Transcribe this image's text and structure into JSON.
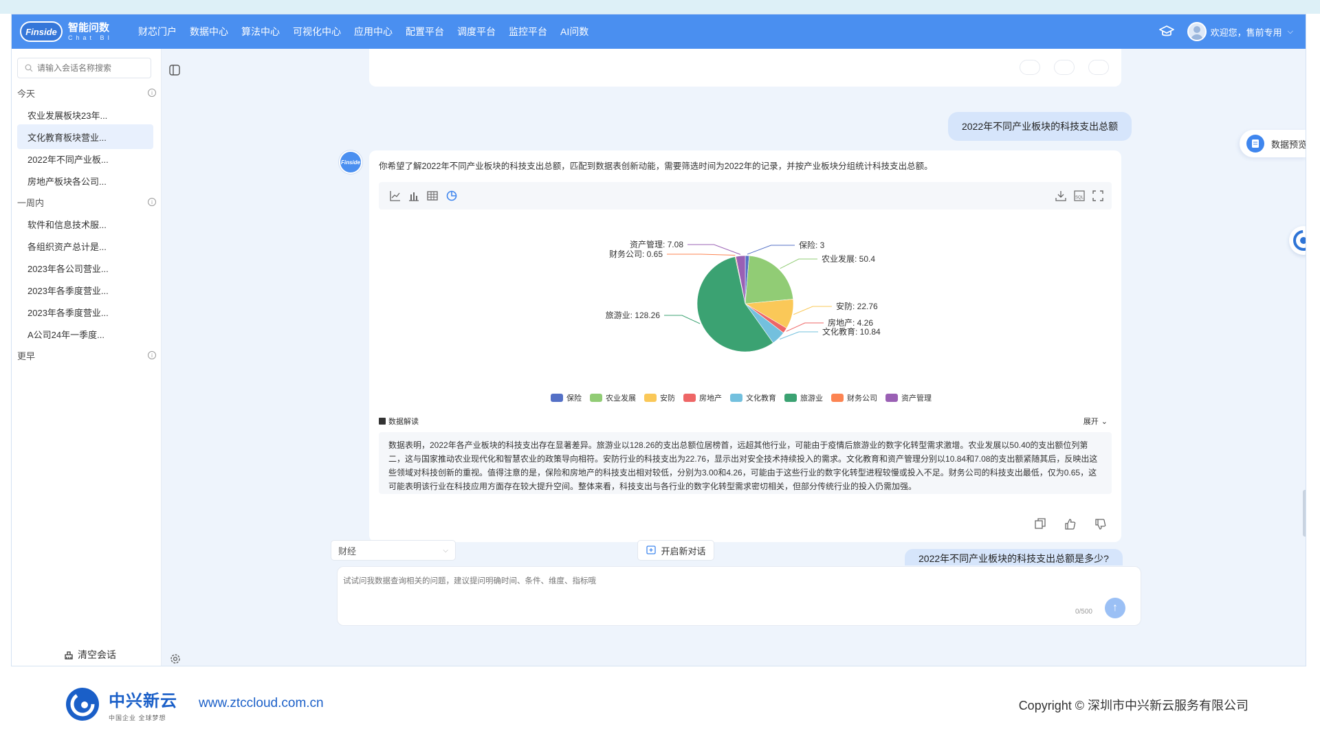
{
  "header": {
    "logo_badge": "Finside",
    "logo_title": "智能问数",
    "logo_subtitle": "Chat BI",
    "nav": [
      "财芯门户",
      "数据中心",
      "算法中心",
      "可视化中心",
      "应用中心",
      "配置平台",
      "调度平台",
      "监控平台",
      "AI问数"
    ],
    "welcome": "欢迎您，售前专用"
  },
  "sidebar": {
    "search_placeholder": "请输入会话名称搜索",
    "groups": [
      {
        "title": "今天",
        "items": [
          "农业发展板块23年...",
          "文化教育板块营业...",
          "2022年不同产业板...",
          "房地产板块各公司..."
        ]
      },
      {
        "title": "一周内",
        "items": [
          "软件和信息技术服...",
          "各组织资产总计是...",
          "2023年各公司营业...",
          "2023年各季度营业...",
          "2023年各季度营业...",
          "A公司24年一季度..."
        ]
      },
      {
        "title": "更早",
        "items": []
      }
    ],
    "active_item": "文化教育板块营业...",
    "clear_label": "清空会话"
  },
  "chat": {
    "user_question_1": "2022年不同产业板块的科技支出总额",
    "bot_avatar_text": "Finside",
    "bot_intro": "你希望了解2022年不同产业板块的科技支出总额，匹配到数据表创新动能，需要筛选时间为2022年的记录，并按产业板块分组统计科技支出总额。",
    "interpretation_label": "数据解读",
    "expand_label": "展开",
    "interpretation_text": "数据表明，2022年各产业板块的科技支出存在显著差异。旅游业以128.26的支出总额位居榜首，远超其他行业，可能由于疫情后旅游业的数字化转型需求激增。农业发展以50.40的支出额位列第二，这与国家推动农业现代化和智慧农业的政策导向相符。安防行业的科技支出为22.76，显示出对安全技术持续投入的需求。文化教育和资产管理分别以10.84和7.08的支出额紧随其后，反映出这些领域对科技创新的重视。值得注意的是，保险和房地产的科技支出相对较低，分别为3.00和4.26，可能由于这些行业的数字化转型进程较慢或投入不足。财务公司的科技支出最低，仅为0.65，这可能表明该行业在科技应用方面存在较大提升空间。整体来看，科技支出与各行业的数字化转型需求密切相关，但部分传统行业的投入仍需加强。",
    "user_question_2": "2022年不同产业板块的科技支出总额是多少?",
    "domain_select": "财经",
    "new_chat_label": "开启新对话",
    "input_placeholder": "试试问我数据查询相关的问题，建议提问明确时间、条件、维度、指标哦",
    "counter": "0/500"
  },
  "right_panel": {
    "data_preview": "数据预览"
  },
  "footer": {
    "brand": "中兴新云",
    "brand_sub": "中国企业 全球梦想",
    "url": "www.ztccloud.com.cn",
    "copyright": "Copyright © 深圳市中兴新云服务有限公司"
  },
  "chart_data": {
    "type": "pie",
    "categories": [
      "保险",
      "农业发展",
      "安防",
      "房地产",
      "文化教育",
      "旅游业",
      "财务公司",
      "资产管理"
    ],
    "values": [
      3,
      50.4,
      22.76,
      4.26,
      10.84,
      128.26,
      0.65,
      7.08
    ],
    "colors": [
      "#5470c6",
      "#91cc75",
      "#fac858",
      "#ee6666",
      "#73c0de",
      "#3ba272",
      "#fc8452",
      "#9a60b4"
    ],
    "title": "",
    "legend_position": "bottom"
  }
}
